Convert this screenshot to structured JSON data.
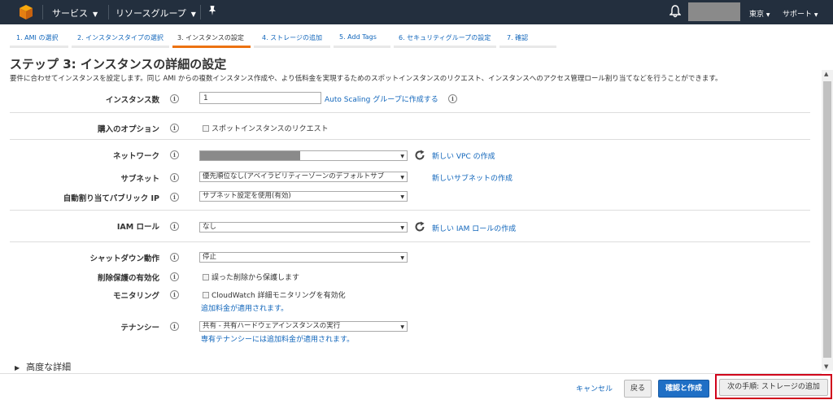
{
  "topnav": {
    "services_label": "サービス",
    "resource_groups_label": "リソースグループ",
    "region_label": "東京",
    "support_label": "サポート"
  },
  "wizard_tabs": [
    {
      "label": "1. AMI の選択"
    },
    {
      "label": "2. インスタンスタイプの選択"
    },
    {
      "label": "3. インスタンスの設定"
    },
    {
      "label": "4. ストレージの追加"
    },
    {
      "label": "5. Add Tags"
    },
    {
      "label": "6. セキュリティグループの設定"
    },
    {
      "label": "7. 確認"
    }
  ],
  "page": {
    "title": "ステップ 3: インスタンスの詳細の設定",
    "description": "要件に合わせてインスタンスを設定します。同じ AMI からの複数インスタンス作成や、より低料金を実現するためのスポットインスタンスのリクエスト、インスタンスへのアクセス管理ロール割り当てなどを行うことができます。"
  },
  "form": {
    "instance_count": {
      "label": "インスタンス数",
      "value": "1",
      "link_prefix": "Auto Scaling",
      "link": "グループに作成する"
    },
    "purchase_option": {
      "label": "購入のオプション",
      "checkbox": "スポットインスタンスのリクエスト"
    },
    "network": {
      "label": "ネットワーク",
      "value": "",
      "link": "新しい VPC の作成"
    },
    "subnet": {
      "label": "サブネット",
      "value": "優先順位なし(アベイラビリティーゾーンのデフォルトサブ",
      "link": "新しいサブネットの作成"
    },
    "public_ip": {
      "label": "自動割り当てパブリック IP",
      "value": "サブネット設定を使用(有効)"
    },
    "iam_role": {
      "label": "IAM ロール",
      "value": "なし",
      "link": "新しい IAM ロールの作成"
    },
    "shutdown": {
      "label": "シャットダウン動作",
      "value": "停止"
    },
    "termination": {
      "label": "削除保護の有効化",
      "checkbox": "誤った削除から保護します"
    },
    "monitoring": {
      "label": "モニタリング",
      "checkbox": "CloudWatch 詳細モニタリングを有効化",
      "note": "追加料金が適用されます。"
    },
    "tenancy": {
      "label": "テナンシー",
      "value": "共有 - 共有ハードウェアインスタンスの実行",
      "note": "専有テナンシーには追加料金が適用されます。"
    }
  },
  "advanced": {
    "label": "高度な詳細"
  },
  "footer": {
    "cancel": "キャンセル",
    "back": "戻る",
    "review": "確認と作成",
    "next": "次の手順: ストレージの追加"
  },
  "colors": {
    "nav_bg": "#232f3e",
    "accent": "#ec7211",
    "link": "#1166bb",
    "primary": "#1f6fc5",
    "highlight": "#d0021b"
  }
}
